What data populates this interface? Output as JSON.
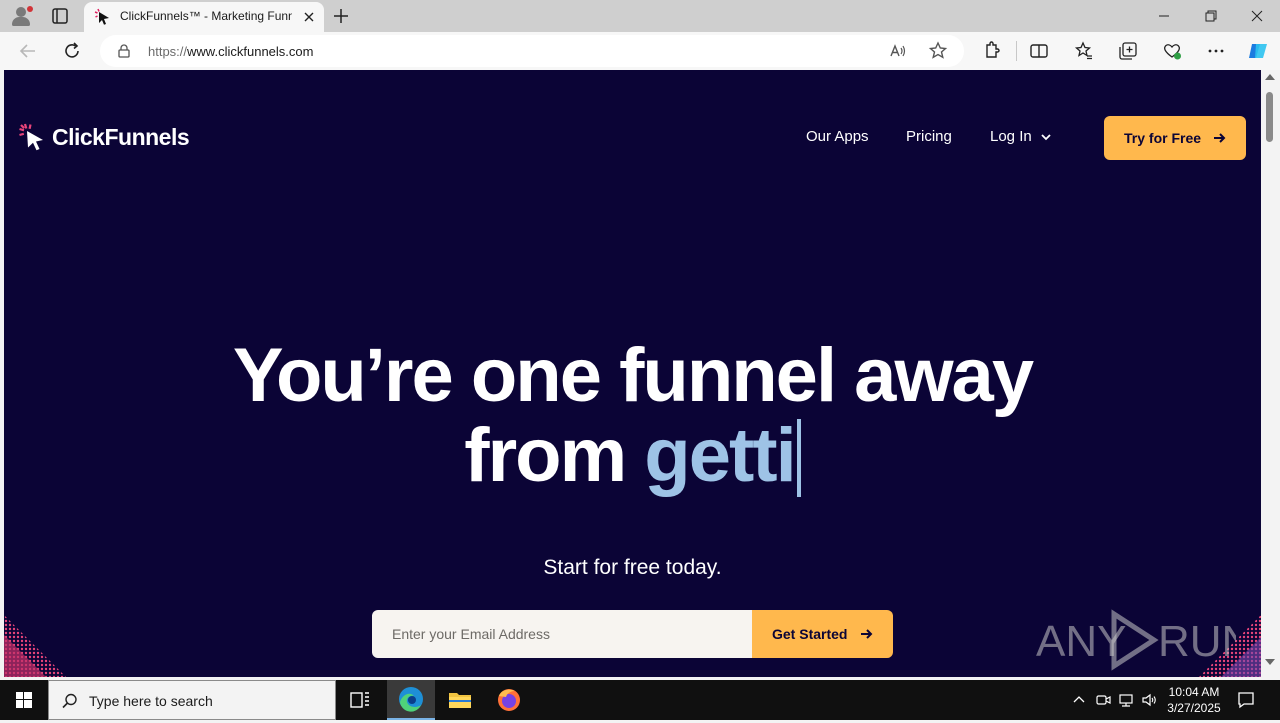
{
  "browser": {
    "tab_title": "ClickFunnels™ - Marketing Funnels",
    "url_protocol": "https://",
    "url_host": "www.clickfunnels.com"
  },
  "page": {
    "brand": "ClickFunnels",
    "nav": {
      "our_apps": "Our Apps",
      "pricing": "Pricing",
      "login": "Log In",
      "try_free": "Try for Free"
    },
    "headline_line1": "You’re one funnel away",
    "headline_line2_static": "from ",
    "headline_line2_typed": "getti",
    "subheadline": "Start for free today.",
    "email_placeholder": "Enter your Email Address",
    "get_started": "Get Started",
    "colors": {
      "background": "#0b0436",
      "accent": "#ffb84d",
      "typed_text": "#9ec3e6"
    }
  },
  "watermark": "ANY RUN",
  "taskbar": {
    "search_placeholder": "Type here to search",
    "time": "10:04 AM",
    "date": "3/27/2025"
  }
}
